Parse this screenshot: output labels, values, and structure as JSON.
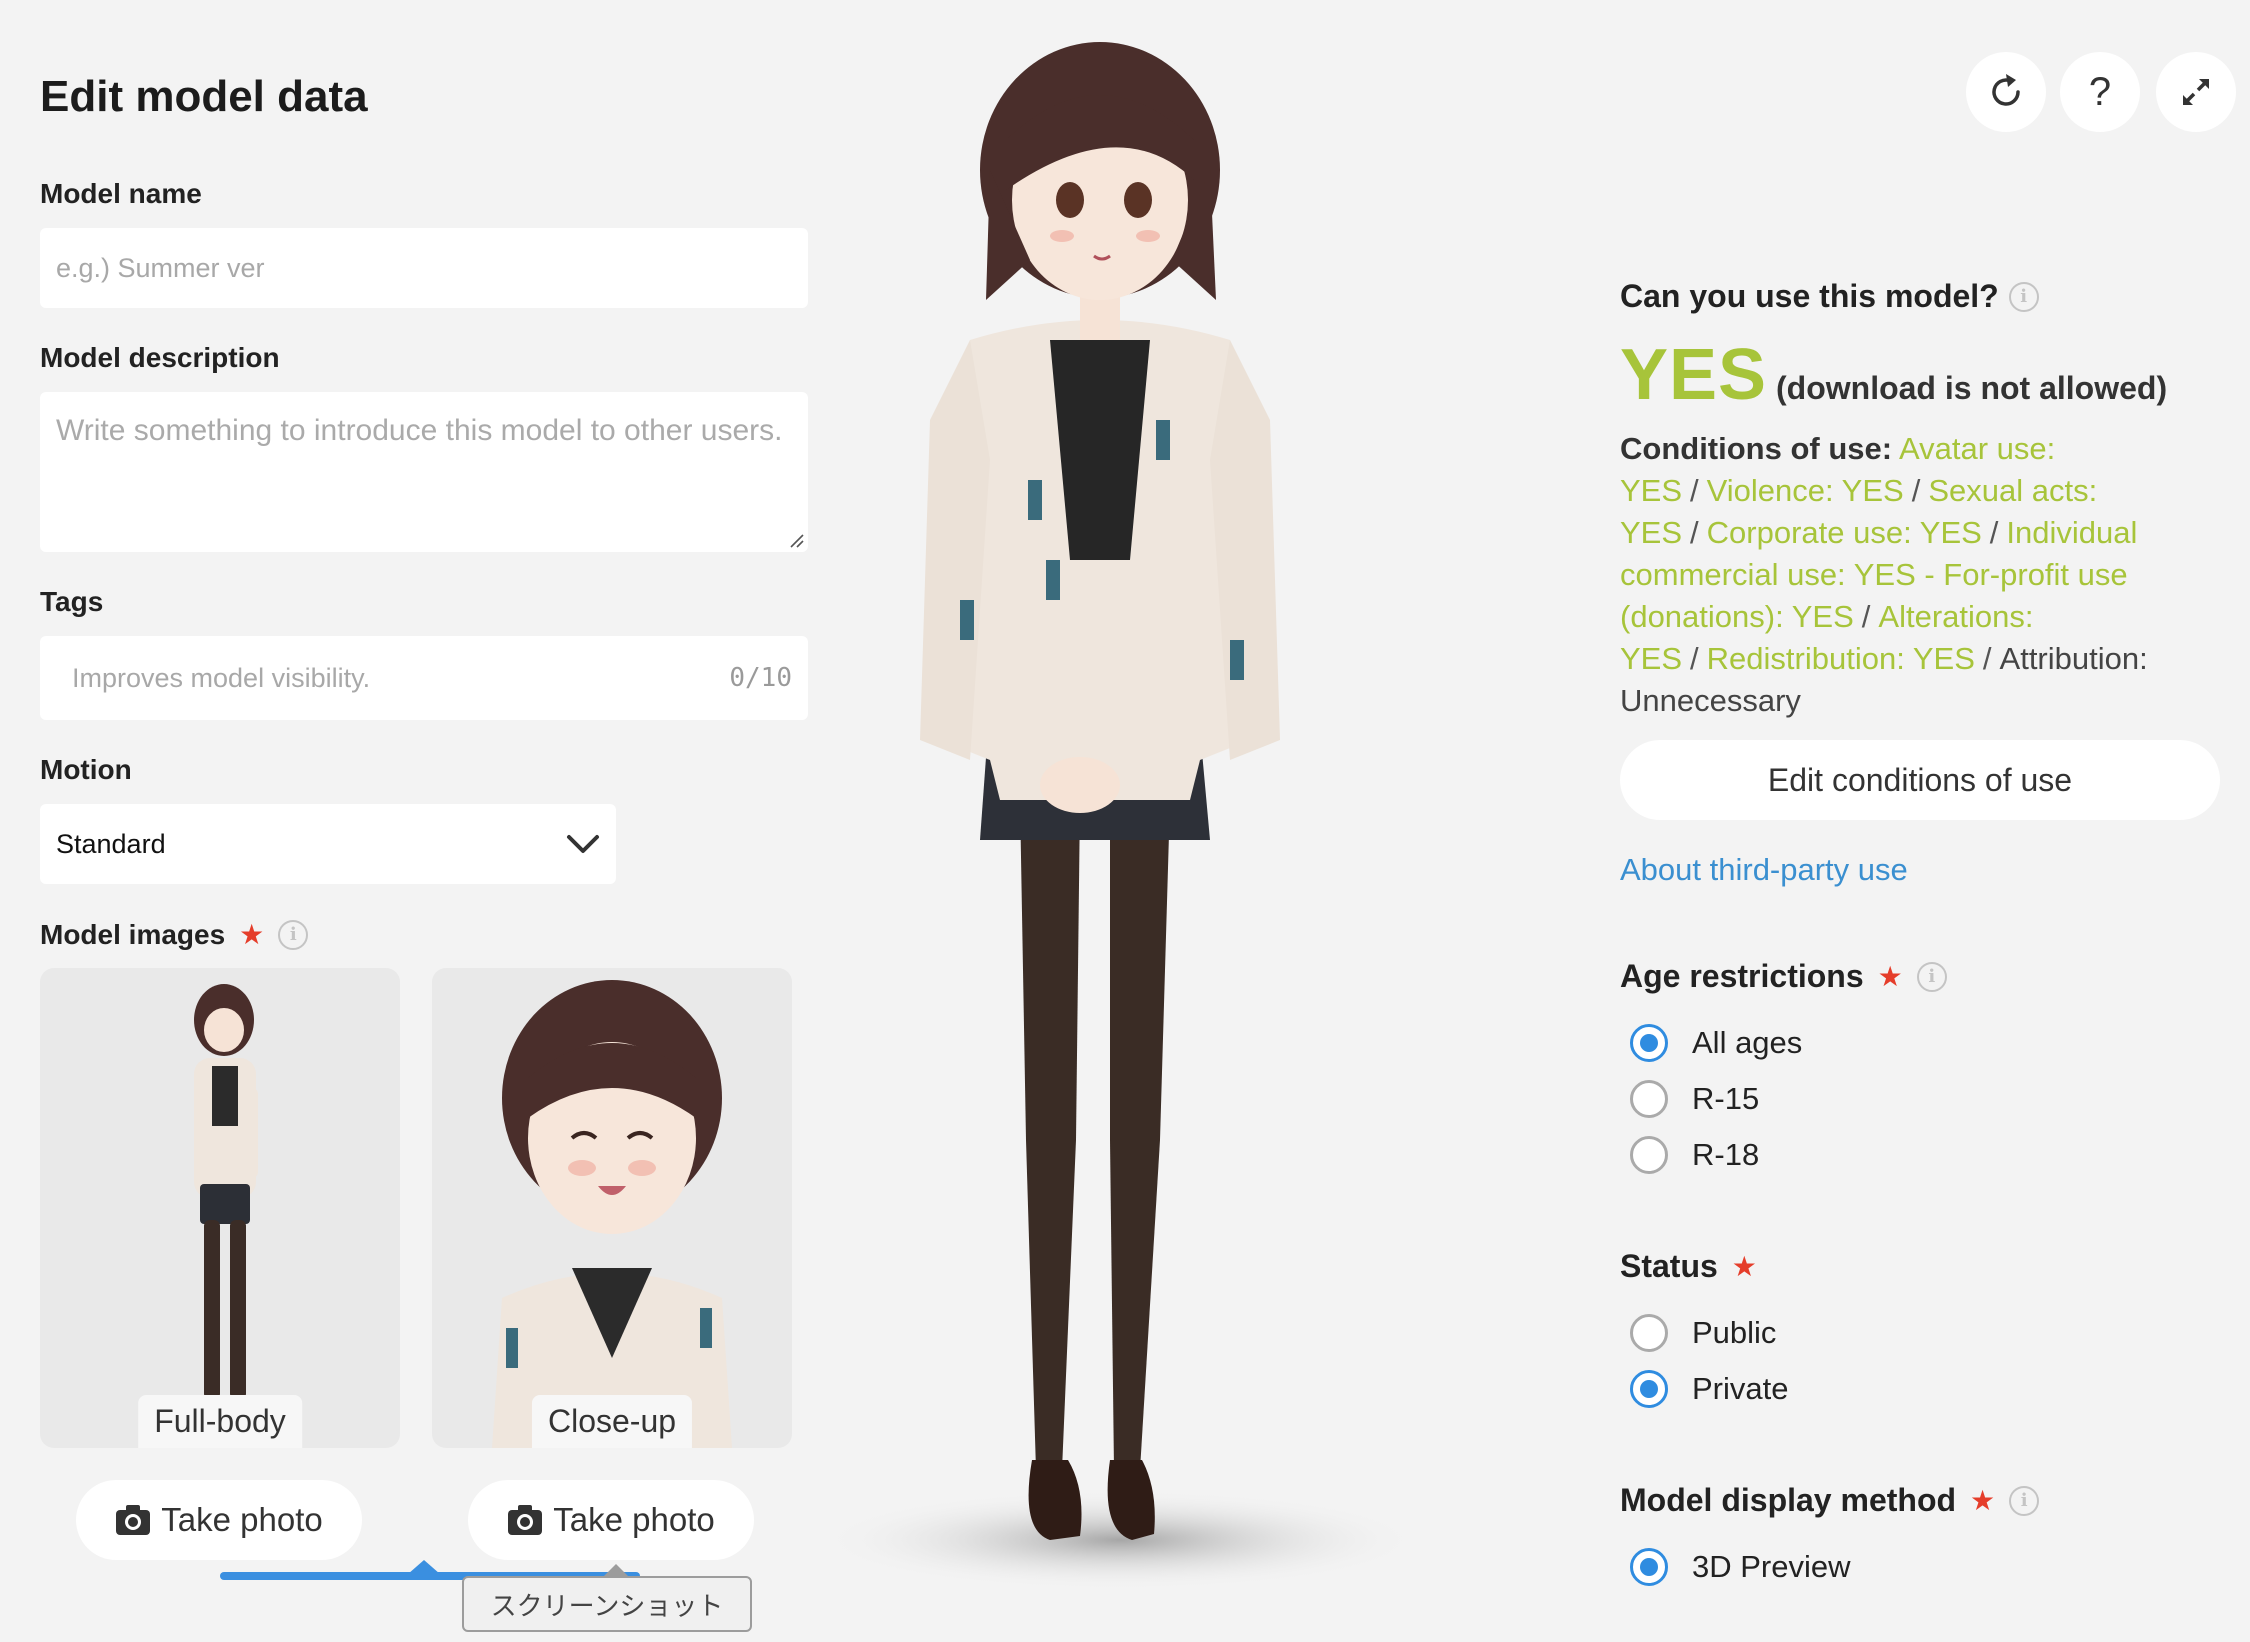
{
  "page": {
    "title": "Edit model data"
  },
  "form": {
    "model_name": {
      "label": "Model name",
      "placeholder": "e.g.) Summer ver",
      "value": ""
    },
    "model_description": {
      "label": "Model description",
      "placeholder": "Write something to introduce this model to other users.",
      "value": ""
    },
    "tags": {
      "label": "Tags",
      "placeholder": "Improves model visibility.",
      "count": "0/10"
    },
    "motion": {
      "label": "Motion",
      "selected": "Standard"
    },
    "model_images": {
      "label": "Model images",
      "required_mark": "★",
      "images": [
        {
          "label": "Full-body",
          "button": "Take photo"
        },
        {
          "label": "Close-up",
          "button": "Take photo"
        }
      ]
    }
  },
  "tooltip": {
    "text": "スクリーンショット"
  },
  "toolbar": {
    "icons": [
      "reload-icon",
      "help-icon",
      "expand-icon"
    ],
    "help_glyph": "?"
  },
  "usage": {
    "heading": "Can you use this model?",
    "answer": "YES",
    "note": "(download is not allowed)",
    "conditions_label": "Conditions of use:",
    "conditions": [
      {
        "text": "Avatar use: YES",
        "highlight": true
      },
      {
        "text": "Violence: YES",
        "highlight": true
      },
      {
        "text": "Sexual acts: YES",
        "highlight": true
      },
      {
        "text": "Corporate use: YES",
        "highlight": true
      },
      {
        "text": "Individual commercial use: YES - For-profit use (donations): YES",
        "highlight": true
      },
      {
        "text": "Alterations: YES",
        "highlight": true
      },
      {
        "text": "Redistribution: YES",
        "highlight": true
      },
      {
        "text": "Attribution: Unnecessary",
        "highlight": false
      }
    ],
    "separator": "/",
    "edit_button": "Edit conditions of use",
    "third_party_link": "About third-party use"
  },
  "age_restrictions": {
    "label": "Age restrictions",
    "options": [
      "All ages",
      "R-15",
      "R-18"
    ],
    "selected": "All ages"
  },
  "status": {
    "label": "Status",
    "options": [
      "Public",
      "Private"
    ],
    "selected": "Private"
  },
  "display_method": {
    "label": "Model display method",
    "options": [
      "3D Preview"
    ],
    "selected": "3D Preview"
  },
  "colors": {
    "accent_green": "#a7c43a",
    "link_blue": "#3a8fd0",
    "radio_blue": "#2f8ce0",
    "required_red": "#e53d2a"
  }
}
